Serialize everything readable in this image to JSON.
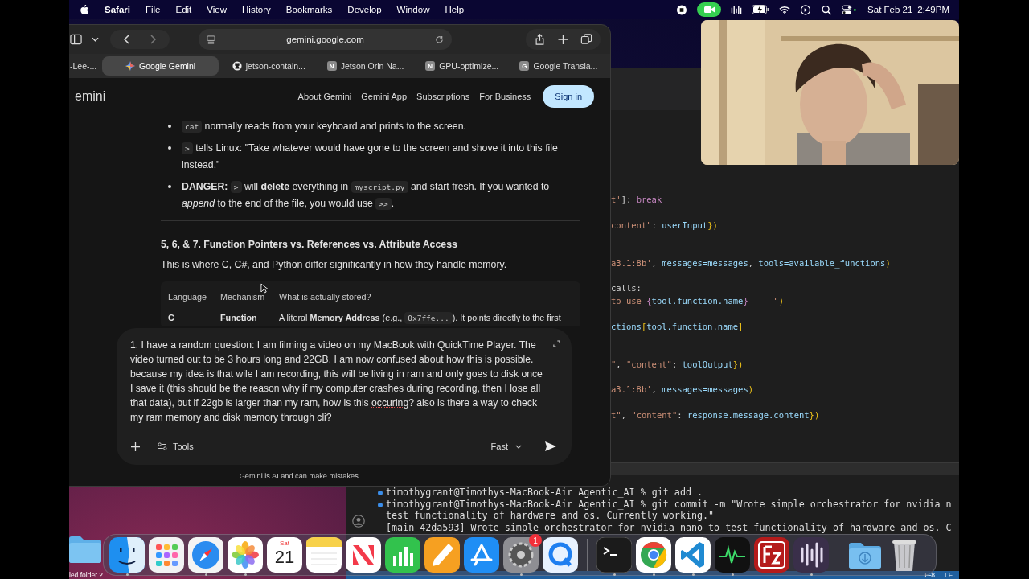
{
  "menu_bar": {
    "app": "Safari",
    "items": [
      "File",
      "Edit",
      "View",
      "History",
      "Bookmarks",
      "Develop",
      "Window",
      "Help"
    ],
    "date": "Sat Feb 21",
    "time": "2:49PM"
  },
  "safari": {
    "address": "gemini.google.com",
    "tabs": [
      {
        "label": "-Lee-...",
        "kind": "plain",
        "selected": false
      },
      {
        "label": "Google Gemini",
        "kind": "sparkle",
        "selected": true
      },
      {
        "label": "jetson-contain...",
        "kind": "github",
        "selected": false
      },
      {
        "label": "Jetson Orin Na...",
        "kind": "letter",
        "letter": "N",
        "selected": false
      },
      {
        "label": "GPU-optimize...",
        "kind": "letter",
        "letter": "N",
        "selected": false
      },
      {
        "label": "Google Transla...",
        "kind": "letter",
        "letter": "G",
        "selected": false
      }
    ]
  },
  "gemini": {
    "brand": "emini",
    "nav": [
      "About Gemini",
      "Gemini App",
      "Subscriptions",
      "For Business"
    ],
    "sign_in": "Sign in",
    "bullets": [
      [
        {
          "kind": "code",
          "text": "cat"
        },
        {
          "kind": "text",
          "text": " normally reads from your keyboard and prints to the screen."
        }
      ],
      [
        {
          "kind": "code",
          "text": ">"
        },
        {
          "kind": "text",
          "text": " tells Linux: \"Take whatever would have gone to the screen and shove it into this file instead.\""
        }
      ],
      [
        {
          "kind": "text",
          "text": "**DANGER:** "
        },
        {
          "kind": "code",
          "text": ">"
        },
        {
          "kind": "text",
          "text": " will **delete** everything in "
        },
        {
          "kind": "code",
          "text": "myscript.py"
        },
        {
          "kind": "text",
          "text": " and start fresh. If you wanted to *append* to the end of the file, you would use "
        },
        {
          "kind": "code",
          "text": ">>"
        },
        {
          "kind": "text",
          "text": "."
        }
      ]
    ],
    "heading": "5, 6, & 7. Function Pointers vs. References vs. Attribute Access",
    "paragraph": "This is where C, C#, and Python differ significantly in how they handle memory.",
    "table": {
      "columns": [
        "Language",
        "Mechanism",
        "What is actually stored?"
      ],
      "rows": [
        {
          "language": "C",
          "mechanism": "Function",
          "stored": [
            {
              "kind": "text",
              "text": "A literal **Memory Address** (e.g., "
            },
            {
              "kind": "code",
              "text": "0x7ffe..."
            },
            {
              "kind": "text",
              "text": "). It points directly to the first"
            }
          ]
        }
      ]
    },
    "prompt": [
      {
        "text": "1. I have a random question: I am filming a video on my MacBook with QuickTime Player. The video turned out to be 3 hours long and 22GB. I am now confused about how this is possible. because my idea is that wile I am recording, this will be living in ram and only goes to disk once I save it (this should be the reason why if my computer crashes during recording, then I lose all that data), but if 22gb is larger than my ram, how is this ",
        "misspelled": false
      },
      {
        "text": "occuring",
        "misspelled": true
      },
      {
        "text": "? also is there a way to check my ram memory and disk memory through cli?",
        "misspelled": false
      }
    ],
    "tools": "Tools",
    "mode": "Fast",
    "disclaimer": "Gemini is AI and can make mistakes."
  },
  "editor": {
    "code_lines": [
      [
        {
          "kind": "s",
          "text": "t'"
        },
        {
          "kind": "p",
          "text": "]: "
        },
        {
          "kind": "k",
          "text": "break"
        }
      ],
      [
        {
          "kind": "s",
          "text": "content\""
        },
        {
          "kind": "p",
          "text": ": "
        },
        {
          "kind": "v",
          "text": "userInput"
        },
        {
          "kind": "b",
          "text": "})"
        }
      ],
      [
        {
          "kind": "s",
          "text": "a3.1:8b'"
        },
        {
          "kind": "p",
          "text": ", "
        },
        {
          "kind": "v",
          "text": "messages=messages"
        },
        {
          "kind": "p",
          "text": ", "
        },
        {
          "kind": "v",
          "text": "tools=available_functions"
        },
        {
          "kind": "b",
          "text": ")"
        }
      ],
      [
        {
          "kind": "p",
          "text": "calls:"
        }
      ],
      [
        {
          "kind": "s",
          "text": "to use "
        },
        {
          "kind": "k",
          "text": "{"
        },
        {
          "kind": "v",
          "text": "tool.function.name"
        },
        {
          "kind": "k",
          "text": "}"
        },
        {
          "kind": "s",
          "text": " ----\""
        },
        {
          "kind": "b",
          "text": ")"
        }
      ],
      [
        {
          "kind": "v",
          "text": "ctions"
        },
        {
          "kind": "b",
          "text": "["
        },
        {
          "kind": "v",
          "text": "tool.function.name"
        },
        {
          "kind": "b",
          "text": "]"
        }
      ],
      [
        {
          "kind": "s",
          "text": "\""
        },
        {
          "kind": "p",
          "text": ", "
        },
        {
          "kind": "s",
          "text": "\"content\""
        },
        {
          "kind": "p",
          "text": ": "
        },
        {
          "kind": "v",
          "text": "toolOutput"
        },
        {
          "kind": "b",
          "text": "})"
        }
      ],
      [
        {
          "kind": "s",
          "text": "a3.1:8b'"
        },
        {
          "kind": "p",
          "text": ", "
        },
        {
          "kind": "v",
          "text": "messages=messages"
        },
        {
          "kind": "b",
          "text": ")"
        }
      ],
      [
        {
          "kind": "s",
          "text": "t\""
        },
        {
          "kind": "p",
          "text": ", "
        },
        {
          "kind": "s",
          "text": "\"content\""
        },
        {
          "kind": "p",
          "text": ": "
        },
        {
          "kind": "v",
          "text": "response.message.content"
        },
        {
          "kind": "b",
          "text": "})"
        }
      ]
    ],
    "terminal_lines": [
      {
        "text": "timothygrant@Timothys-MacBook-Air Agentic_AI % git add .",
        "prompt": true
      },
      {
        "text": "timothygrant@Timothys-MacBook-Air Agentic_AI % git commit -m \"Wrote simple orchestrator for nvidia n",
        "prompt": true
      },
      {
        "text": "test functionality of hardware and os. Currently working.\"",
        "prompt": false
      },
      {
        "text": "[main 42da593] Wrote simple orchestrator for nvidia nano to test functionality of hardware and os. C",
        "prompt": false
      }
    ],
    "status": [
      "F-8",
      "LF"
    ]
  },
  "desktop": {
    "folder_label": "led folder 2"
  },
  "dock": {
    "items": [
      {
        "kind": "finder",
        "running": true
      },
      {
        "kind": "launchpad",
        "running": false
      },
      {
        "kind": "safari",
        "running": true
      },
      {
        "kind": "photos",
        "running": true
      },
      {
        "kind": "calendar",
        "running": false,
        "day": "Sat",
        "date": "21"
      },
      {
        "kind": "notes",
        "running": false
      },
      {
        "kind": "news",
        "running": false
      },
      {
        "kind": "numbers",
        "running": false
      },
      {
        "kind": "pages",
        "running": false
      },
      {
        "kind": "appstore",
        "running": false
      },
      {
        "kind": "settings",
        "running": true,
        "badge": "1"
      },
      {
        "kind": "quicktime",
        "running": false
      },
      {
        "kind": "separator"
      },
      {
        "kind": "terminal",
        "running": true
      },
      {
        "kind": "chrome",
        "running": true
      },
      {
        "kind": "vscode",
        "running": true
      },
      {
        "kind": "activity",
        "running": true
      },
      {
        "kind": "filezilla",
        "running": false
      },
      {
        "kind": "bars",
        "running": true
      },
      {
        "kind": "separator"
      },
      {
        "kind": "downloads",
        "running": false
      },
      {
        "kind": "trash",
        "running": false
      }
    ]
  }
}
